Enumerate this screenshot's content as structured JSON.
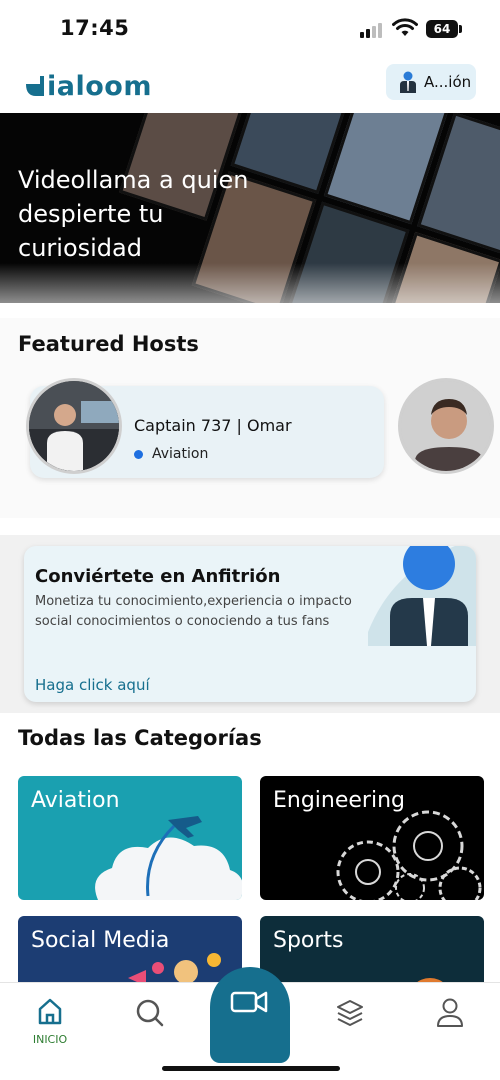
{
  "status_bar": {
    "time": "17:45",
    "battery": "64"
  },
  "header": {
    "logo_text": "ialoom",
    "account_label": "A...ión"
  },
  "hero": {
    "headline": "Videollama a quien despierte tu curiosidad"
  },
  "featured": {
    "title": "Featured Hosts",
    "hosts": [
      {
        "name": "Captain 737 | Omar",
        "category": "Aviation"
      }
    ]
  },
  "promo": {
    "title": "Conviértete en Anfitrión",
    "description": "Monetiza tu conocimiento,experiencia o impacto social conocimientos o conociendo a tus fans",
    "link": "Haga click aquí"
  },
  "categories": {
    "title": "Todas las Categorías",
    "items": [
      {
        "label": "Aviation"
      },
      {
        "label": "Engineering"
      },
      {
        "label": "Social Media"
      },
      {
        "label": "Sports"
      }
    ]
  },
  "nav": {
    "home_label": "INICIO"
  },
  "colors": {
    "brand": "#166f8e",
    "aviation_bg": "#1aa0b0",
    "engineering_bg": "#000000",
    "social_bg": "#1c3d73",
    "sports_bg": "#0d2d3a",
    "nav_active": "#2e7d32"
  },
  "icons": [
    "signal-icon",
    "wifi-icon",
    "battery-icon",
    "user-icon",
    "home-icon",
    "search-icon",
    "video-camera-icon",
    "layers-icon",
    "profile-icon"
  ]
}
